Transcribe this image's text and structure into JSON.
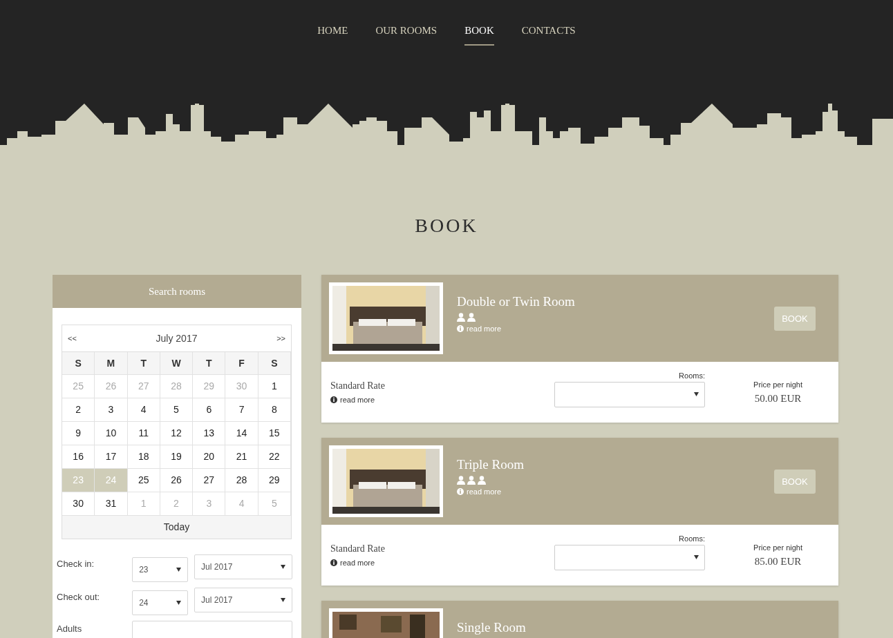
{
  "nav": [
    {
      "label": "HOME",
      "selected": false
    },
    {
      "label": "OUR ROOMS",
      "selected": false
    },
    {
      "label": "BOOK",
      "selected": true
    },
    {
      "label": "CONTACTS",
      "selected": false
    }
  ],
  "page_title": "BOOK",
  "search": {
    "title": "Search rooms",
    "calendar": {
      "prev": "<<",
      "month": "July 2017",
      "next": ">>",
      "weekdays": [
        "S",
        "M",
        "T",
        "W",
        "T",
        "F",
        "S"
      ],
      "weeks": [
        [
          {
            "day": "25",
            "muted": true,
            "selected": false
          },
          {
            "day": "26",
            "muted": true,
            "selected": false
          },
          {
            "day": "27",
            "muted": true,
            "selected": false
          },
          {
            "day": "28",
            "muted": true,
            "selected": false
          },
          {
            "day": "29",
            "muted": true,
            "selected": false
          },
          {
            "day": "30",
            "muted": true,
            "selected": false
          },
          {
            "day": "1",
            "muted": false,
            "selected": false
          }
        ],
        [
          {
            "day": "2",
            "muted": false,
            "selected": false
          },
          {
            "day": "3",
            "muted": false,
            "selected": false
          },
          {
            "day": "4",
            "muted": false,
            "selected": false
          },
          {
            "day": "5",
            "muted": false,
            "selected": false
          },
          {
            "day": "6",
            "muted": false,
            "selected": false
          },
          {
            "day": "7",
            "muted": false,
            "selected": false
          },
          {
            "day": "8",
            "muted": false,
            "selected": false
          }
        ],
        [
          {
            "day": "9",
            "muted": false,
            "selected": false
          },
          {
            "day": "10",
            "muted": false,
            "selected": false
          },
          {
            "day": "11",
            "muted": false,
            "selected": false
          },
          {
            "day": "12",
            "muted": false,
            "selected": false
          },
          {
            "day": "13",
            "muted": false,
            "selected": false
          },
          {
            "day": "14",
            "muted": false,
            "selected": false
          },
          {
            "day": "15",
            "muted": false,
            "selected": false
          }
        ],
        [
          {
            "day": "16",
            "muted": false,
            "selected": false
          },
          {
            "day": "17",
            "muted": false,
            "selected": false
          },
          {
            "day": "18",
            "muted": false,
            "selected": false
          },
          {
            "day": "19",
            "muted": false,
            "selected": false
          },
          {
            "day": "20",
            "muted": false,
            "selected": false
          },
          {
            "day": "21",
            "muted": false,
            "selected": false
          },
          {
            "day": "22",
            "muted": false,
            "selected": false
          }
        ],
        [
          {
            "day": "23",
            "muted": false,
            "selected": true
          },
          {
            "day": "24",
            "muted": false,
            "selected": true
          },
          {
            "day": "25",
            "muted": false,
            "selected": false
          },
          {
            "day": "26",
            "muted": false,
            "selected": false
          },
          {
            "day": "27",
            "muted": false,
            "selected": false
          },
          {
            "day": "28",
            "muted": false,
            "selected": false
          },
          {
            "day": "29",
            "muted": false,
            "selected": false
          }
        ],
        [
          {
            "day": "30",
            "muted": false,
            "selected": false
          },
          {
            "day": "31",
            "muted": false,
            "selected": false
          },
          {
            "day": "1",
            "muted": true,
            "selected": false
          },
          {
            "day": "2",
            "muted": true,
            "selected": false
          },
          {
            "day": "3",
            "muted": true,
            "selected": false
          },
          {
            "day": "4",
            "muted": true,
            "selected": false
          },
          {
            "day": "5",
            "muted": true,
            "selected": false
          }
        ]
      ],
      "today": "Today"
    },
    "fields": [
      {
        "label": "Check in:",
        "day": "23",
        "month": "Jul 2017"
      },
      {
        "label": "Check out:",
        "day": "24",
        "month": "Jul 2017"
      }
    ],
    "adults_label": "Adults"
  },
  "rooms": [
    {
      "name": "Double or Twin Room",
      "guests": [
        {
          "kind": "person"
        },
        {
          "kind": "person"
        }
      ],
      "read_more": "read more",
      "book": "BOOK",
      "rate": "Standard Rate",
      "rate_read_more": "read more",
      "rooms_label": "Rooms:",
      "price_label": "Price per night",
      "price": "50.00 EUR"
    },
    {
      "name": "Triple Room",
      "guests": [
        {
          "kind": "person"
        },
        {
          "kind": "person"
        },
        {
          "kind": "person"
        }
      ],
      "read_more": "read more",
      "book": "BOOK",
      "rate": "Standard Rate",
      "rate_read_more": "read more",
      "rooms_label": "Rooms:",
      "price_label": "Price per night",
      "price": "85.00 EUR"
    },
    {
      "name": "Single Room"
    }
  ]
}
